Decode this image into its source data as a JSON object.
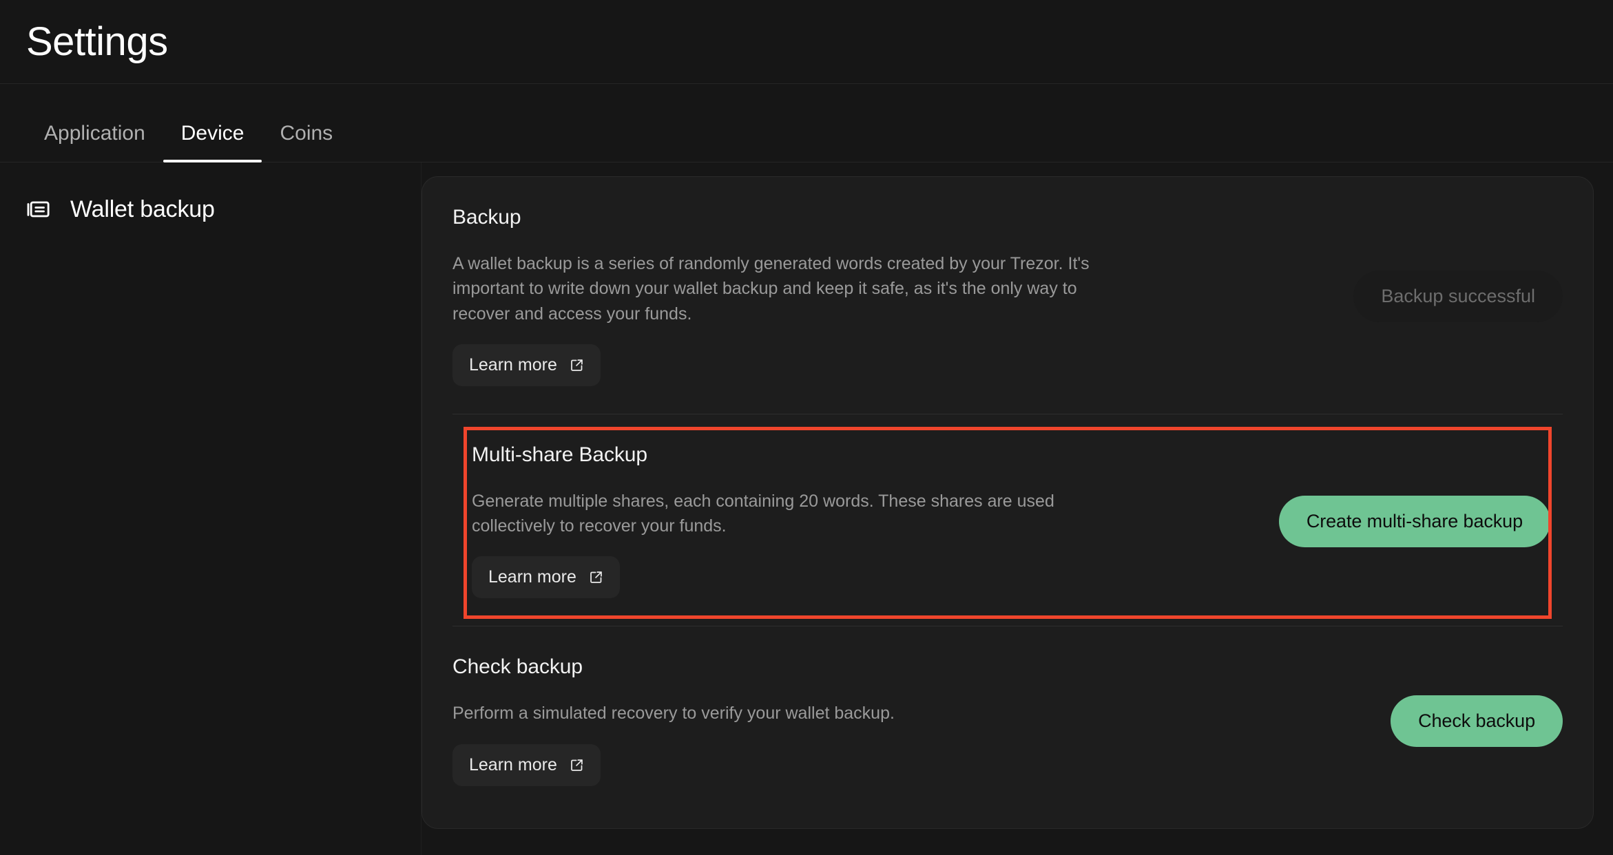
{
  "header": {
    "title": "Settings"
  },
  "tabs": [
    {
      "id": "application",
      "label": "Application",
      "active": false
    },
    {
      "id": "device",
      "label": "Device",
      "active": true
    },
    {
      "id": "coins",
      "label": "Coins",
      "active": false
    }
  ],
  "sidebar": {
    "icon": "wallet-backup-icon",
    "label": "Wallet backup"
  },
  "sections": [
    {
      "id": "backup",
      "title": "Backup",
      "description": "A wallet backup is a series of randomly generated words created by your Trezor. It's important to write down your wallet backup and keep it safe, as it's the only way to recover and access your funds.",
      "learn_more_label": "Learn more",
      "action_label": "Backup successful",
      "action_state": "disabled",
      "highlighted": false
    },
    {
      "id": "multi-share-backup",
      "title": "Multi-share Backup",
      "description": "Generate multiple shares, each containing 20 words. These shares are used collectively to recover your funds.",
      "learn_more_label": "Learn more",
      "action_label": "Create multi-share backup",
      "action_state": "primary",
      "highlighted": true
    },
    {
      "id": "check-backup",
      "title": "Check backup",
      "description": "Perform a simulated recovery to verify your wallet backup.",
      "learn_more_label": "Learn more",
      "action_label": "Check backup",
      "action_state": "primary",
      "highlighted": false
    }
  ],
  "colors": {
    "page_background": "#161616",
    "card_background": "#1d1d1d",
    "accent_green": "#6fc493",
    "highlight_red": "#f0452c",
    "text_primary": "#ffffff",
    "text_secondary": "#9a9a9a"
  },
  "icons": {
    "external_link": "external-link-icon"
  }
}
